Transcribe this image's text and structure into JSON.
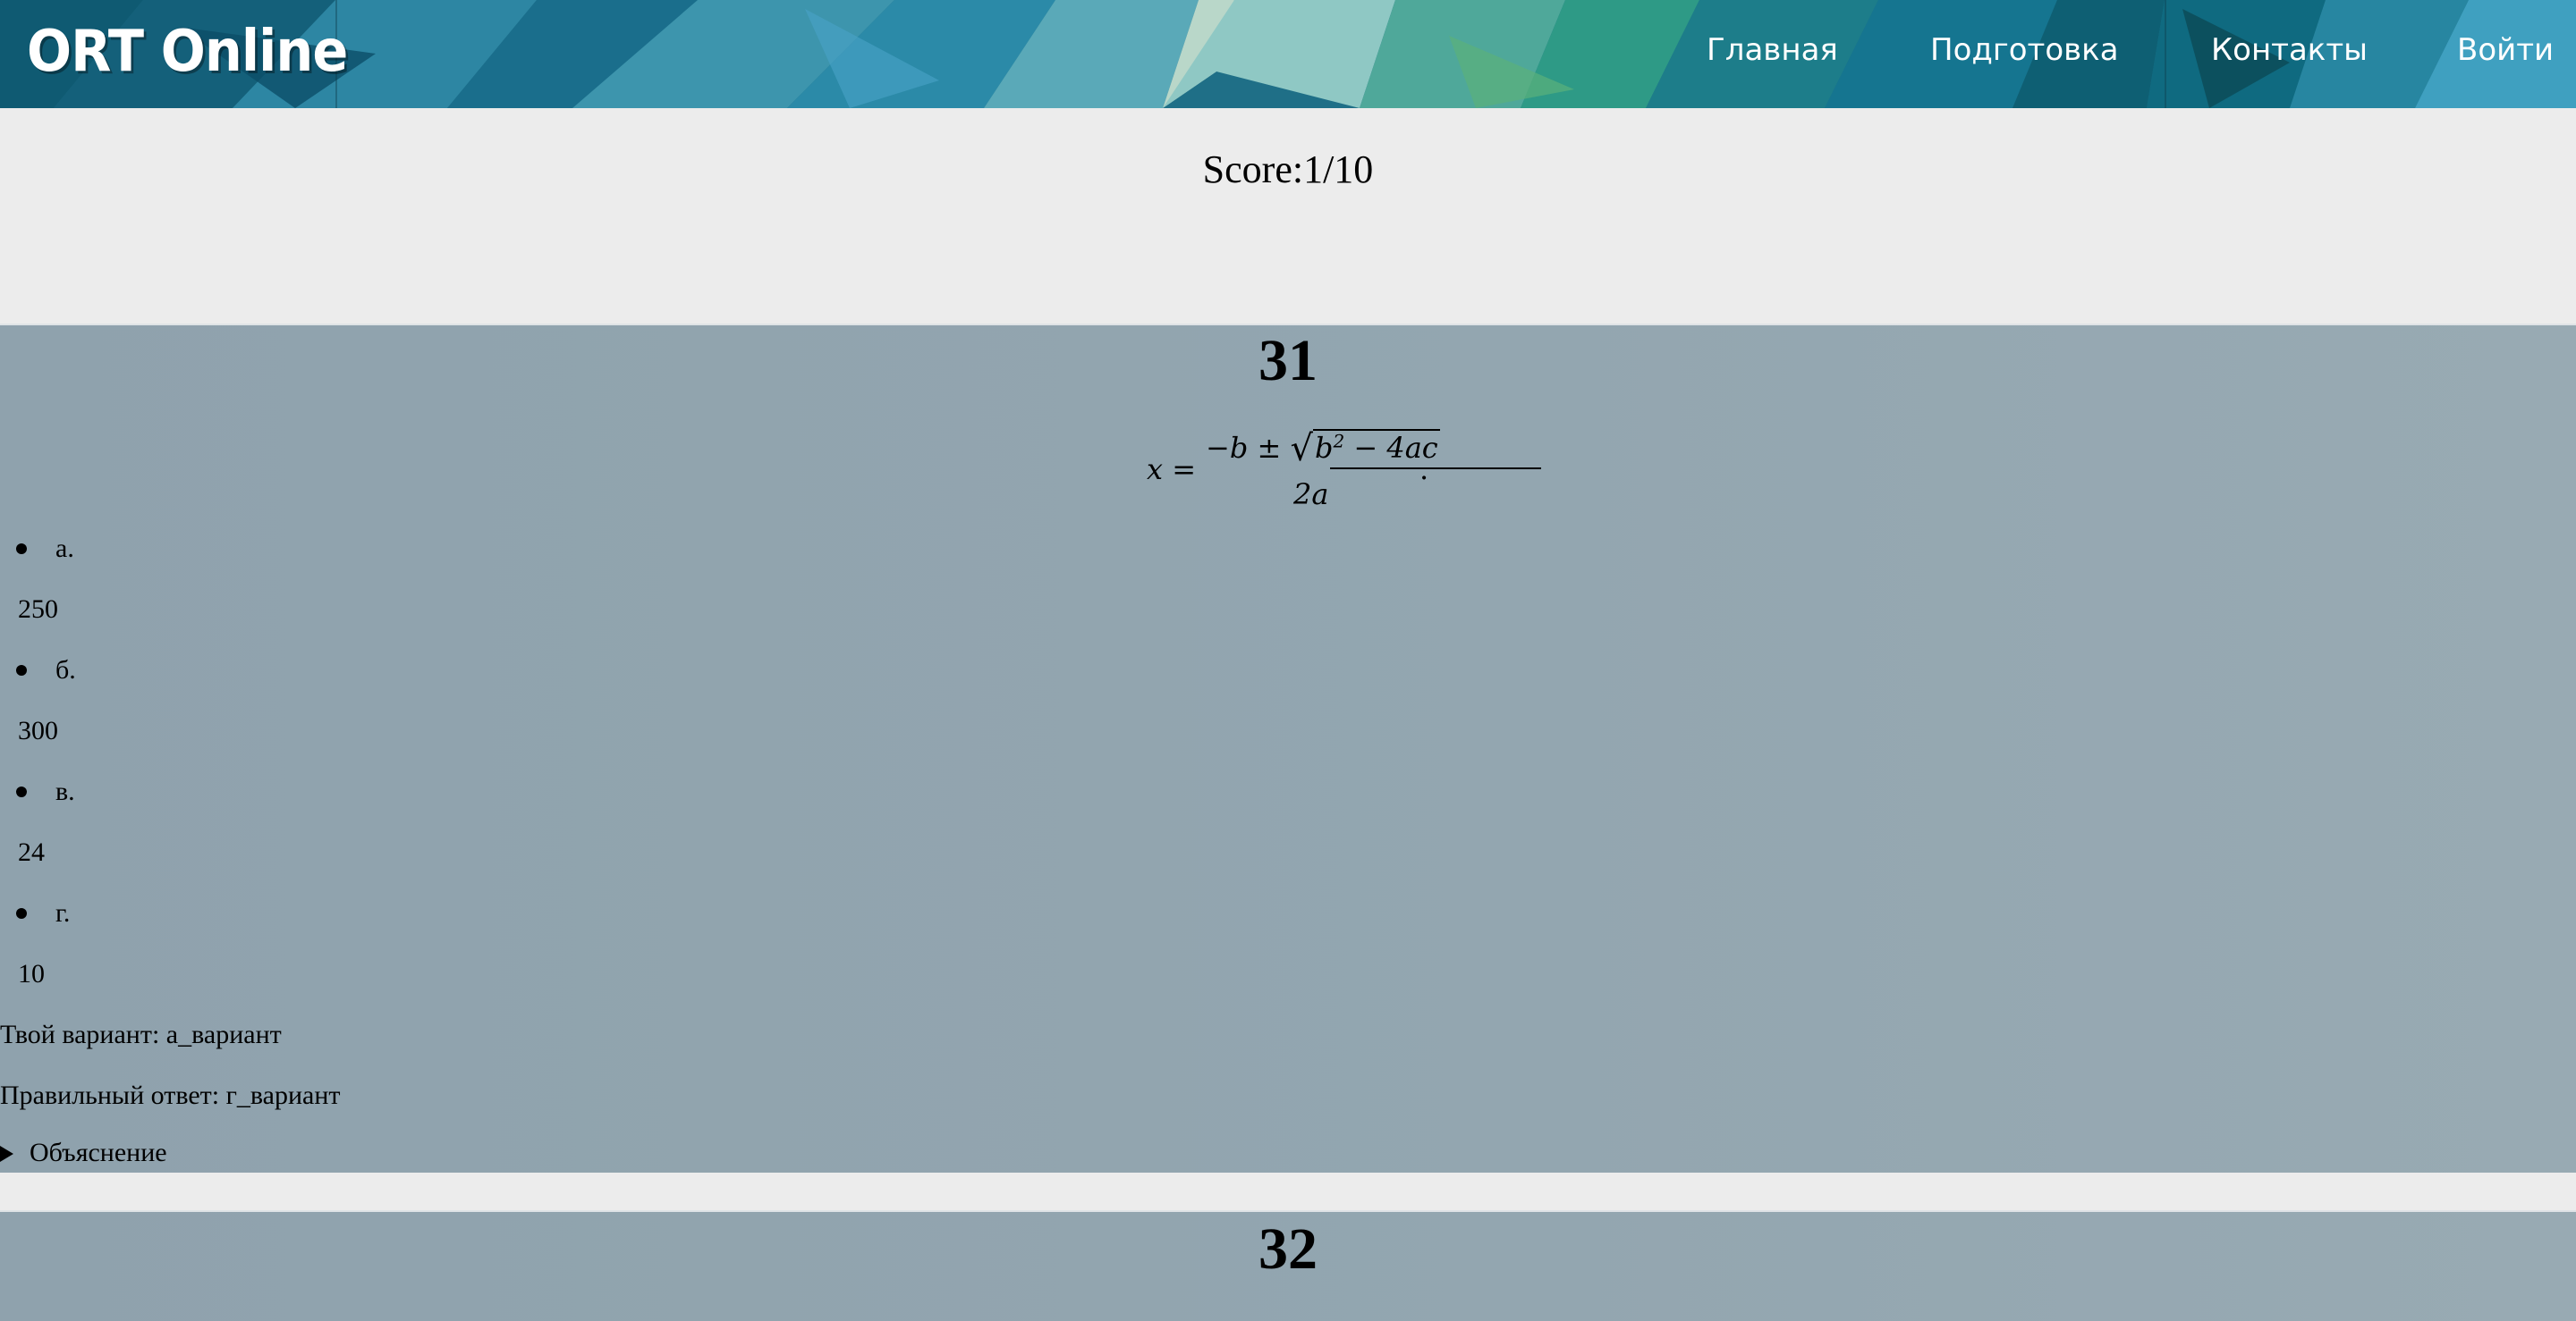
{
  "header": {
    "logo": "ORT Online",
    "nav": {
      "home": "Главная",
      "prep": "Подготовка",
      "contacts": "Контакты",
      "login": "Войти"
    }
  },
  "score": "Score:1/10",
  "questions": [
    {
      "number": "31",
      "formula": {
        "lhs": "x =",
        "numerator_prefix": "−b ± ",
        "radicand_b": "b",
        "radicand_exp": "2",
        "radicand_rest": " − 4ac",
        "denominator": "2a",
        "trailing": "."
      },
      "options": [
        {
          "label": "а.",
          "value": "250"
        },
        {
          "label": "б.",
          "value": "300"
        },
        {
          "label": "в.",
          "value": "24"
        },
        {
          "label": "г.",
          "value": "10"
        }
      ],
      "your_answer": "Твой вариант: а_вариант",
      "correct_answer": "Правильный ответ: г_вариант",
      "explanation_label": "Объяснение"
    },
    {
      "number": "32"
    }
  ]
}
